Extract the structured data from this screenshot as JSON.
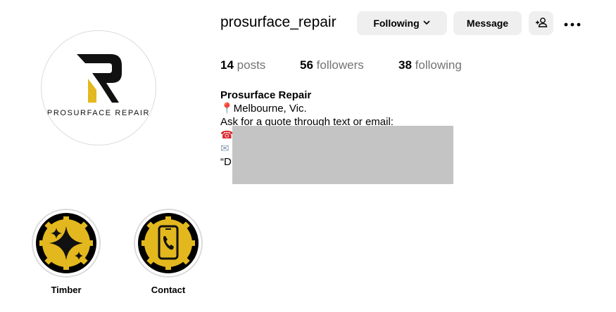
{
  "profile": {
    "username": "prosurface_repair",
    "avatar_brand_text": "PROSURFACE REPAIR"
  },
  "actions": {
    "following_label": "Following",
    "message_label": "Message"
  },
  "stats": {
    "posts_count": "14",
    "posts_label": "posts",
    "followers_count": "56",
    "followers_label": "followers",
    "following_count": "38",
    "following_label": "following"
  },
  "bio": {
    "name": "Prosurface Repair",
    "location": "📍Melbourne, Vic.",
    "line2": "Ask for a quote through text or email:",
    "phone_icon": "☎",
    "email_icon": "✉",
    "quote_start": "“D"
  },
  "highlights": [
    {
      "label": "Timber",
      "icon": "sparkle-icon"
    },
    {
      "label": "Contact",
      "icon": "phone-icon"
    }
  ],
  "colors": {
    "brand_yellow": "#e3b81e",
    "button_bg": "#efefef",
    "secondary_text": "#737373",
    "redaction": "#c4c4c4"
  }
}
